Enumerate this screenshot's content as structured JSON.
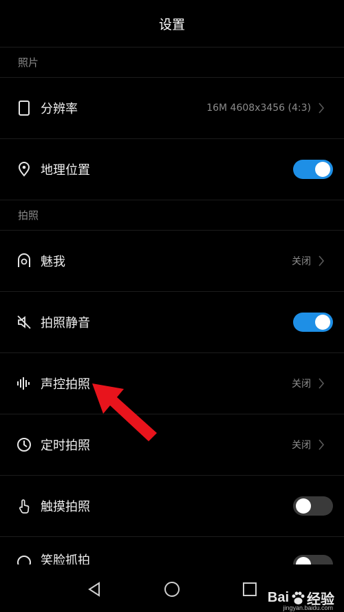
{
  "header": {
    "title": "设置"
  },
  "sections": {
    "photo": "照片",
    "shoot": "拍照"
  },
  "rows": {
    "resolution": {
      "label": "分辨率",
      "value": "16M 4608x3456 (4:3)"
    },
    "location": {
      "label": "地理位置",
      "toggle": "on"
    },
    "beauty": {
      "label": "魅我",
      "value": "关闭"
    },
    "mute": {
      "label": "拍照静音",
      "toggle": "on"
    },
    "voice": {
      "label": "声控拍照",
      "value": "关闭"
    },
    "timer": {
      "label": "定时拍照",
      "value": "关闭"
    },
    "touch": {
      "label": "触摸拍照",
      "toggle": "off"
    },
    "smile": {
      "label": "笑脸抓拍",
      "toggle": "off"
    }
  },
  "watermark": {
    "brand_left": "Bai",
    "brand_right": "经验",
    "url": "jingyan.baidu.com"
  },
  "colors": {
    "accent": "#1e8fe6",
    "arrow": "#e8141c",
    "background": "#000000"
  },
  "icons": {
    "resolution": "phone-outline-icon",
    "location": "location-pin-icon",
    "beauty": "beauty-face-icon",
    "mute": "speaker-muted-icon",
    "voice": "sound-wave-icon",
    "timer": "clock-icon",
    "touch": "touch-hand-icon",
    "smile": "smile-icon"
  }
}
